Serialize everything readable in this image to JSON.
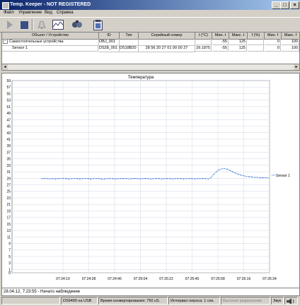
{
  "window": {
    "title": "Temp. Keeper - NOT REGISTERED"
  },
  "menu": [
    "Файл",
    "Управление",
    "Вид",
    "Справка"
  ],
  "toolbar": {
    "buttons": [
      "play-icon",
      "stop-icon",
      "bell-icon",
      "graph-icon",
      "sensors-icon",
      "clipboard-icon"
    ]
  },
  "table": {
    "headers": [
      "Объект / Устройство",
      "ID",
      "Тип",
      "Серийный номер",
      "t (°C)",
      "Мин. t",
      "Макс. t",
      "f (%)",
      "Мин. f",
      "Макс. f"
    ],
    "rows": [
      {
        "object": "Самостоятельные устройства",
        "id": "OBJ_001",
        "type": "",
        "serial": "",
        "t": "",
        "tmin": "-55",
        "tmax": "125",
        "f": "",
        "fmin": "0",
        "fmax": "100"
      },
      {
        "object": "Sensor 1",
        "id": "DS28_001",
        "type": "DS18B20",
        "serial": "28 56 20 27 01 00 00 27",
        "t": "29.1875",
        "tmin": "-55",
        "tmax": "125",
        "f": "",
        "fmin": "0",
        "fmax": "100"
      }
    ]
  },
  "chart_data": {
    "type": "line",
    "title": "Температура",
    "ylim": [
      0,
      59
    ],
    "yticks": [
      "0",
      "1",
      "3",
      "5",
      "7",
      "9",
      "11",
      "13",
      "15",
      "17",
      "19",
      "21",
      "23",
      "25",
      "27",
      "29",
      "31",
      "33",
      "35",
      "37",
      "39",
      "41",
      "43",
      "45",
      "47",
      "49",
      "51",
      "53",
      "55",
      "57",
      "59"
    ],
    "xticks": [
      "07:24:10",
      "07:24:28",
      "07:24:46",
      "07:25:04",
      "07:25:22",
      "07:25:40",
      "07:25:58",
      "07:26:16",
      "07:26:34"
    ],
    "grid": true,
    "legend_position": "right",
    "series": [
      {
        "name": "Sensor 1",
        "color": "#1f5fd0",
        "values": [
          28.9,
          28.9,
          28.9,
          28.8,
          28.9,
          28.8,
          28.9,
          28.9,
          29.0,
          28.9,
          28.8,
          28.9,
          28.9,
          28.9,
          28.8,
          28.9,
          28.9,
          28.9,
          28.8,
          28.9,
          28.9,
          28.9,
          28.8,
          28.8,
          28.9,
          28.9,
          28.9,
          28.8,
          28.9,
          28.9,
          28.9,
          28.9,
          28.8,
          28.9,
          28.9,
          28.9,
          28.8,
          28.9,
          28.9,
          28.9,
          28.8,
          28.9,
          28.9,
          28.9,
          28.8,
          28.9,
          28.9,
          28.9,
          28.8,
          28.9,
          28.9,
          28.9,
          28.8,
          28.9,
          28.9,
          28.9,
          28.8,
          28.9,
          28.9,
          28.9,
          28.9,
          28.8,
          29.2,
          30.2,
          31.0,
          31.6,
          31.9,
          32.0,
          31.8,
          31.4,
          31.0,
          30.6,
          30.3,
          30.0,
          29.8,
          29.6,
          29.5,
          29.4,
          29.3,
          29.3,
          29.2,
          29.2,
          29.2,
          29.1
        ]
      }
    ]
  },
  "status_line": "28.04.12, 7:23:55 - Начато наблюдение",
  "statusbar": {
    "device": "DS9490 на USB",
    "conversion": "Время конвертирования: 750 uS.",
    "interval": "Интервал опроса: 1 сек.",
    "resolution": "Высокое разрешение",
    "sound": "Звук"
  }
}
